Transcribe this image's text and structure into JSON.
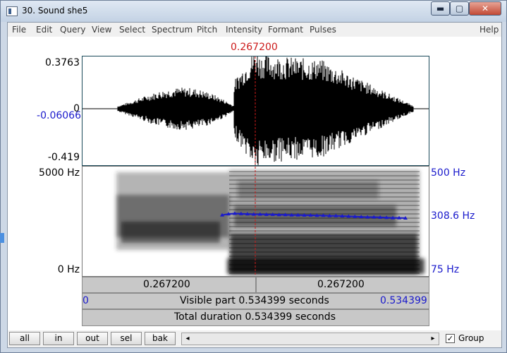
{
  "window": {
    "title": "30. Sound she5",
    "controls": {
      "minimize": "▬",
      "maximize": "▢",
      "close": "✕"
    }
  },
  "menu": [
    "File",
    "Edit",
    "Query",
    "View",
    "Select",
    "Spectrum",
    "Pitch",
    "Intensity",
    "Formant",
    "Pulses",
    "Help"
  ],
  "cursor": {
    "time_label": "0.267200"
  },
  "waveform": {
    "max_label": "0.3763",
    "zero_label": "0",
    "cursor_value_label": "-0.06066",
    "min_label": "-0.419"
  },
  "spectrogram": {
    "top_freq_label": "5000 Hz",
    "bottom_freq_label": "0 Hz",
    "pitch_top_label": "500 Hz",
    "pitch_value_label": "308.6 Hz",
    "pitch_bottom_label": "75 Hz",
    "pitch_track": {
      "range_hz": [
        75,
        500
      ],
      "time_range": [
        0.18,
        0.48
      ],
      "points_hz": [
        312,
        316,
        318,
        317,
        316,
        315,
        315,
        314,
        314,
        313,
        313,
        312,
        312,
        311,
        311,
        310,
        310,
        309,
        309,
        308,
        307,
        306,
        305,
        304,
        304,
        303,
        302,
        301,
        301,
        300
      ]
    }
  },
  "time_bars": {
    "left_segment": "0.267200",
    "right_segment": "0.267200",
    "visible_start": "0",
    "visible_text": "Visible part 0.534399 seconds",
    "visible_end": "0.534399",
    "total_text": "Total duration 0.534399 seconds"
  },
  "buttons": [
    "all",
    "in",
    "out",
    "sel",
    "bak"
  ],
  "group": {
    "label": "Group",
    "checked": "✓"
  },
  "scrollbar": {
    "left_arrow": "◂",
    "right_arrow": "▸"
  },
  "colors": {
    "pitch": "#1a1acc",
    "cursor": "#cc1a1a",
    "wave": "#000000"
  }
}
